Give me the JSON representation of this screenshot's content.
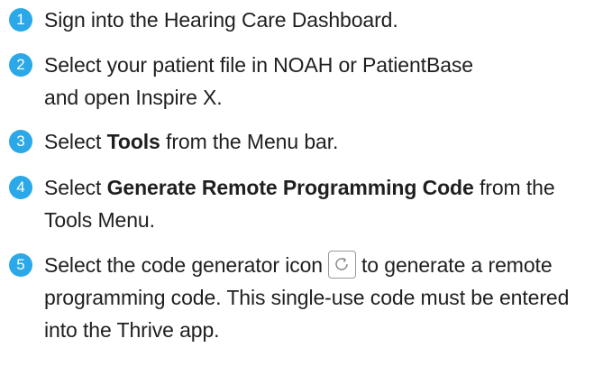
{
  "colors": {
    "badge": "#2aa8e8",
    "text": "#1f1f1f"
  },
  "steps": [
    {
      "number": "1",
      "text": "Sign into the Hearing Care Dashboard."
    },
    {
      "number": "2",
      "text": "Select your patient file in NOAH or PatientBase and open Inspire X."
    },
    {
      "number": "3",
      "before": "Select ",
      "bold": "Tools",
      "after": " from the Menu bar."
    },
    {
      "number": "4",
      "before": "Select ",
      "bold": "Generate Remote Programming Code",
      "after": " from the Tools Menu."
    },
    {
      "number": "5",
      "before": "Select the code generator icon",
      "icon": "refresh-icon",
      "after": "to generate a remote programming code. This single-use code must be entered into the Thrive app."
    }
  ]
}
